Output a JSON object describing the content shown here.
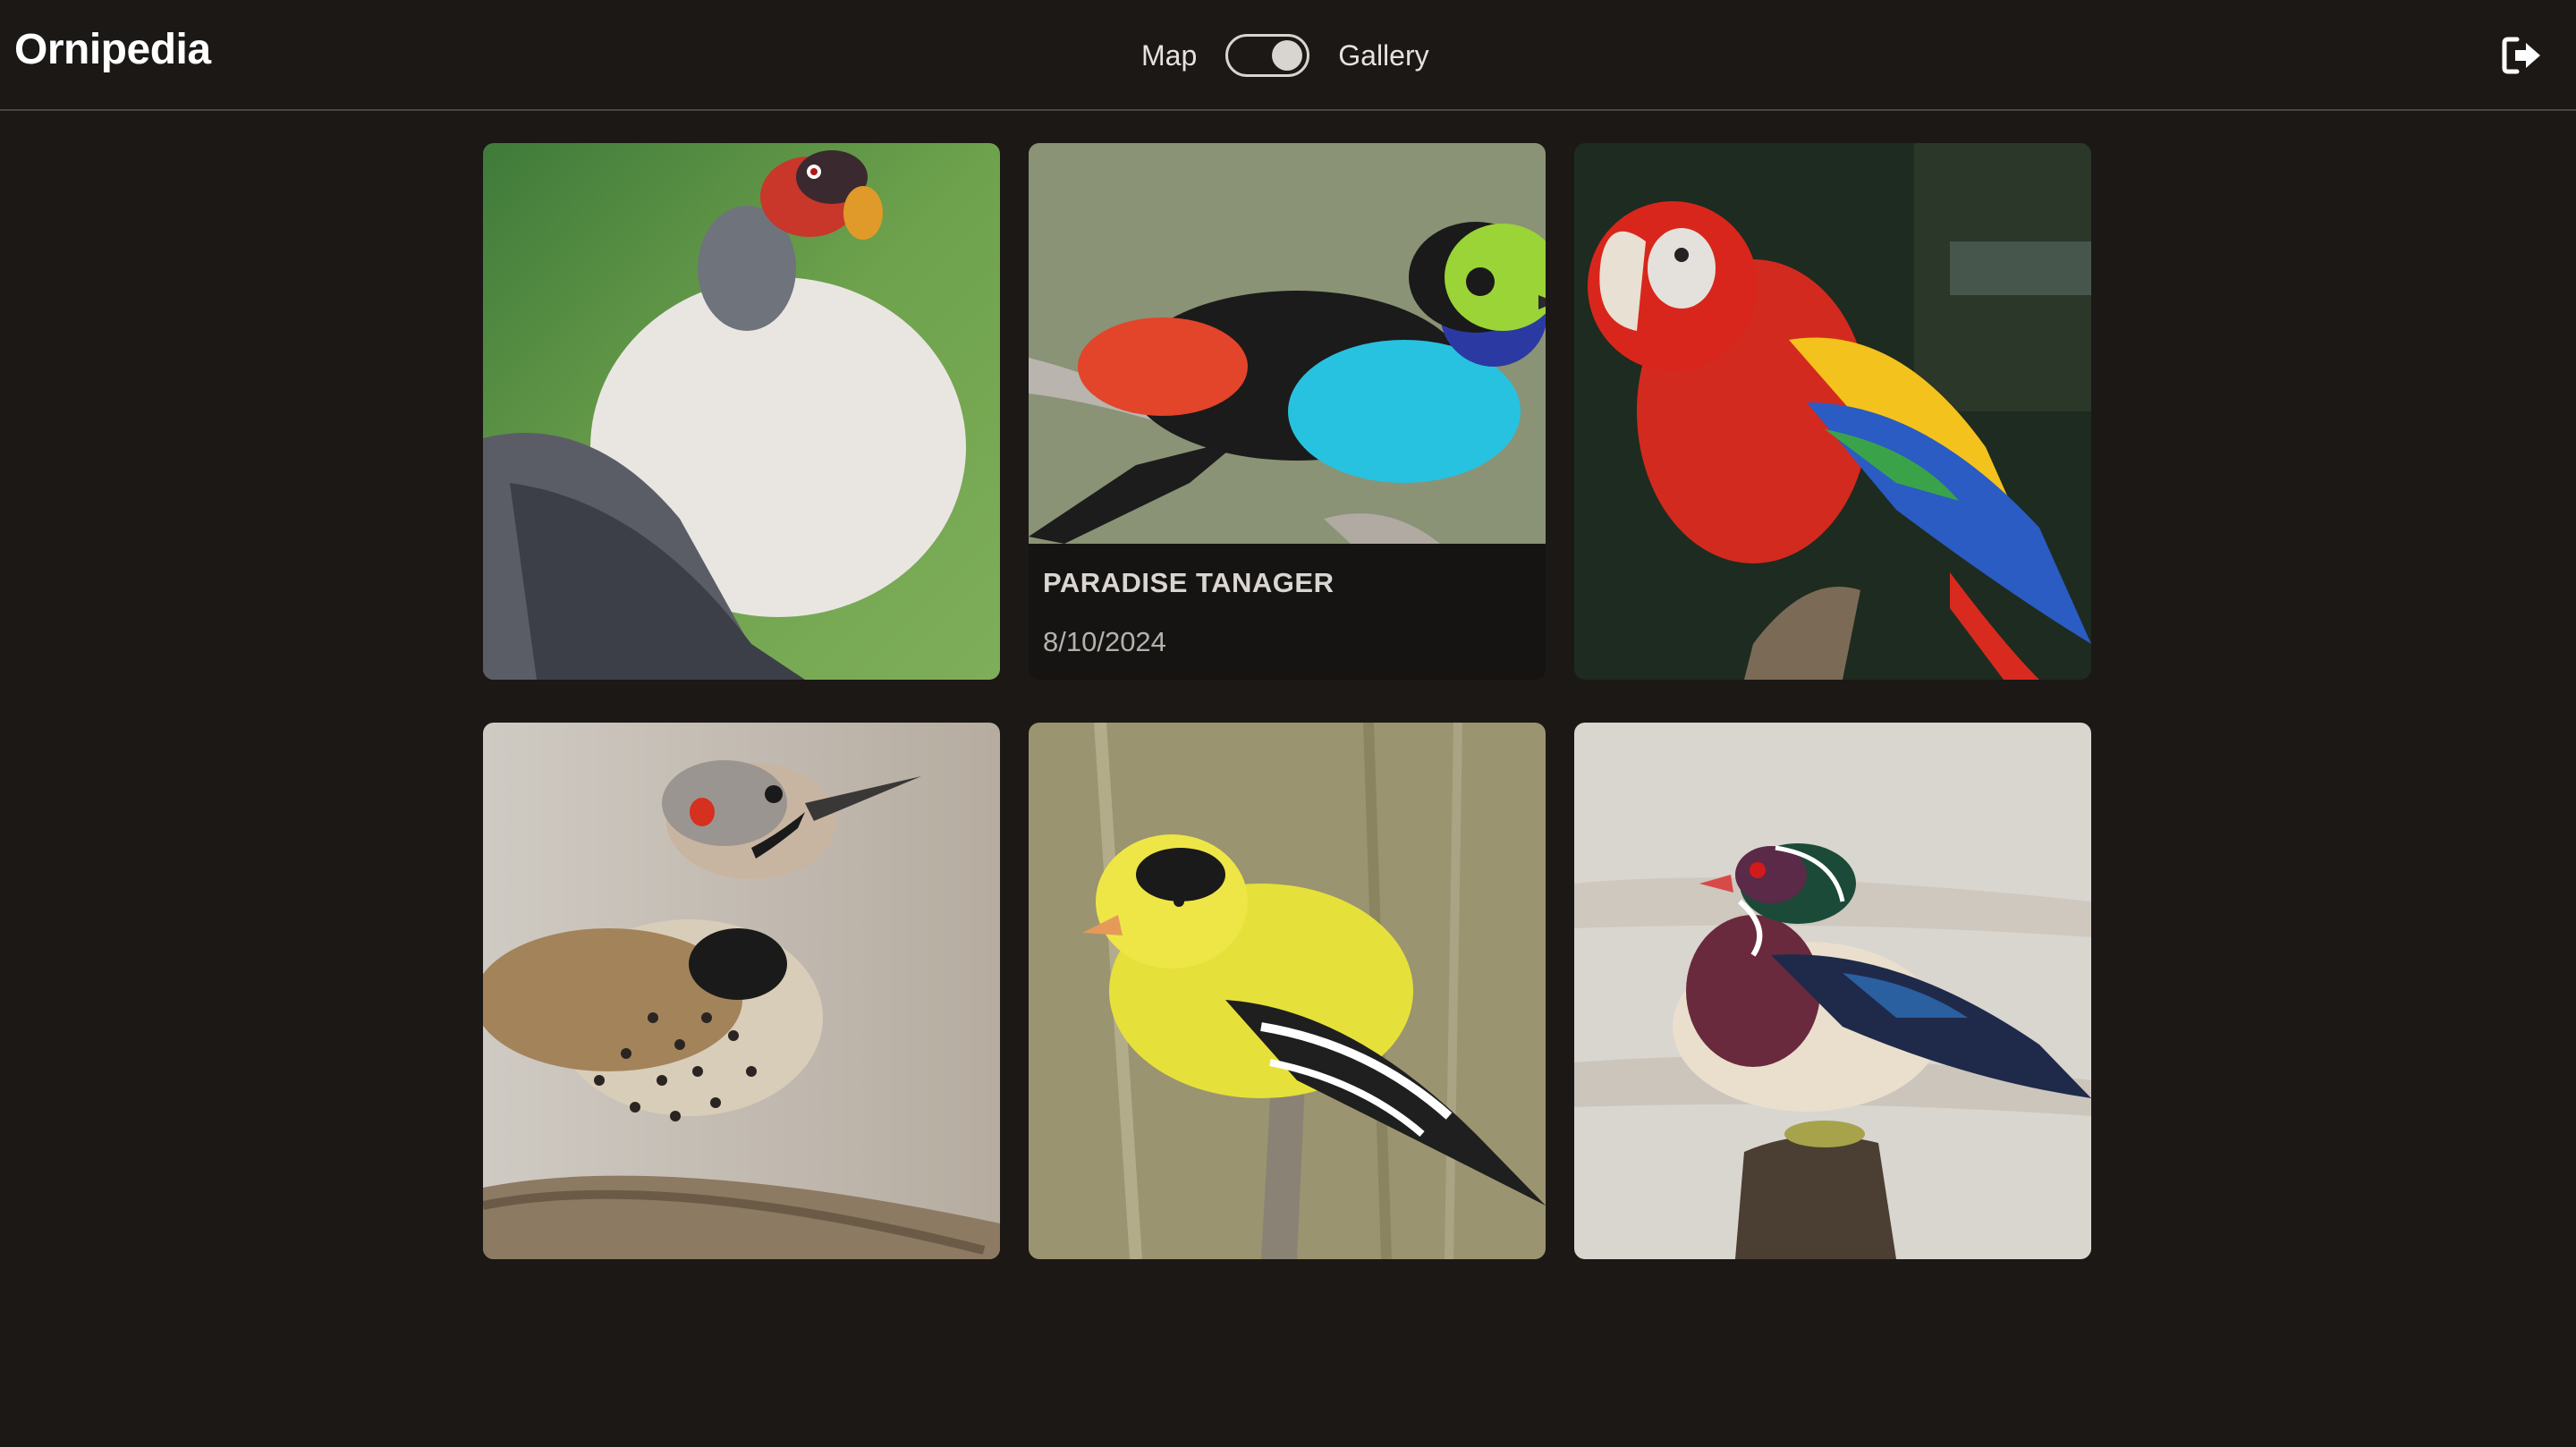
{
  "app": {
    "title": "Ornipedia"
  },
  "view_toggle": {
    "left_label": "Map",
    "right_label": "Gallery",
    "selected": "Gallery"
  },
  "header": {
    "logout_icon": "sign-out-icon"
  },
  "gallery": {
    "cards": [
      {
        "name": "",
        "date": "",
        "photo": "king-vulture-photo"
      },
      {
        "name": "PARADISE TANAGER",
        "date": "8/10/2024",
        "photo": "paradise-tanager-photo"
      },
      {
        "name": "",
        "date": "",
        "photo": "scarlet-macaw-photo"
      },
      {
        "name": "",
        "date": "",
        "photo": "northern-flicker-photo"
      },
      {
        "name": "",
        "date": "",
        "photo": "american-goldfinch-photo"
      },
      {
        "name": "",
        "date": "",
        "photo": "wood-duck-photo"
      }
    ]
  },
  "colors": {
    "background": "#1b1816",
    "header_border": "#4a4643",
    "card_info_bg": "#161412",
    "text_primary": "#ffffff",
    "text_muted": "#b5b1ac"
  }
}
